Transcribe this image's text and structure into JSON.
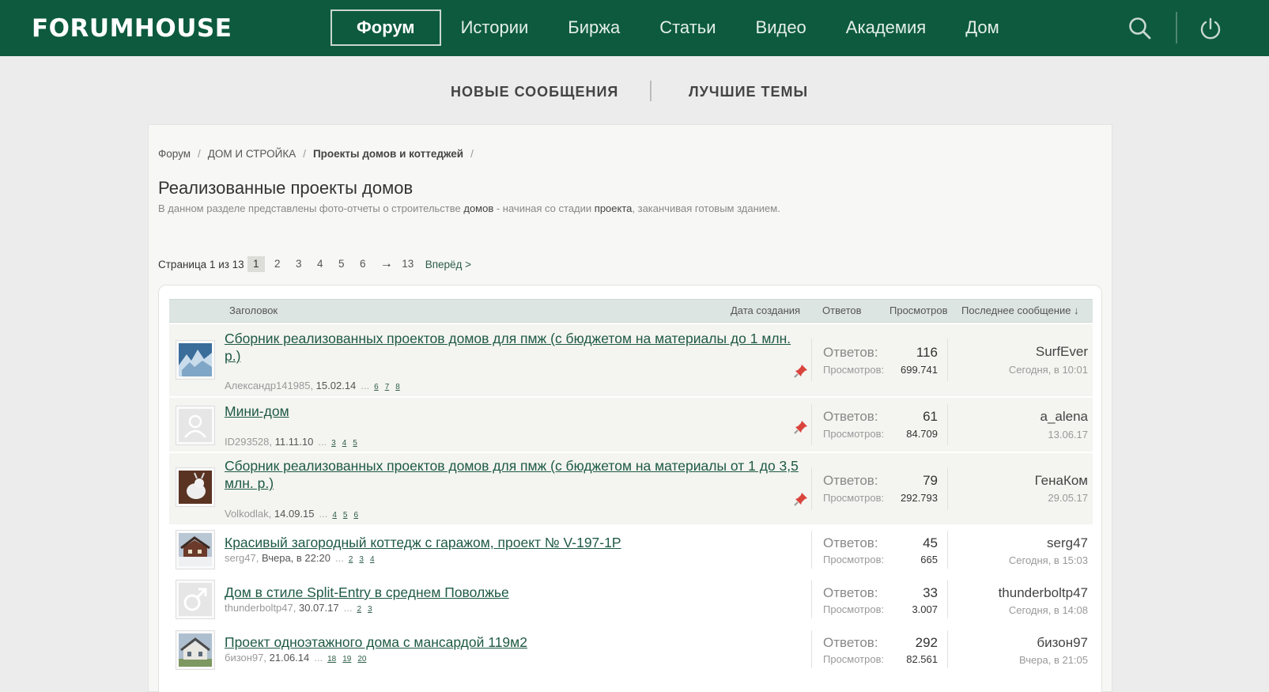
{
  "brand": {
    "logo": "FORUMHOUSE",
    "accent": "#0d5a3f"
  },
  "nav": {
    "items": [
      {
        "label": "Форум",
        "active": true
      },
      {
        "label": "Истории"
      },
      {
        "label": "Биржа"
      },
      {
        "label": "Статьи"
      },
      {
        "label": "Видео"
      },
      {
        "label": "Академия"
      },
      {
        "label": "Дом"
      }
    ],
    "icons": [
      "search-icon",
      "power-icon"
    ]
  },
  "subnav": {
    "new_messages": "НОВЫЕ СООБЩЕНИЯ",
    "best_topics": "ЛУЧШИЕ ТЕМЫ"
  },
  "breadcrumb": {
    "items": [
      "Форум",
      "ДОМ И СТРОЙКА",
      "Проекты домов и коттеджей"
    ],
    "sep": "/"
  },
  "page": {
    "title": "Реализованные проекты домов",
    "desc_1": "В данном разделе представлены фото-отчеты о строительстве ",
    "desc_2": "домов",
    "desc_3": " - начиная со стадии ",
    "desc_4": "проекта",
    "desc_5": ", заканчивая готовым зданием."
  },
  "pager": {
    "label": "Страница 1 из 13",
    "pages": [
      "1",
      "2",
      "3",
      "4",
      "5",
      "6"
    ],
    "arrow": "→",
    "last": "13",
    "next": "Вперёд >"
  },
  "list": {
    "headers": {
      "title": "Заголовок",
      "created": "Дата создания",
      "replies": "Ответов",
      "views": "Просмотров",
      "last": "Последнее сообщение ↓"
    },
    "replies_label": "Ответов:",
    "views_label": "Просмотров:",
    "threads": [
      {
        "title": "Сборник реализованных проектов домов для пмж (с бюджетом на материалы до 1 млн. р.)",
        "author": "Александр141985",
        "date": "15.02.14",
        "pages": [
          "6",
          "7",
          "8"
        ],
        "replies": "116",
        "views": "699.741",
        "last_user": "SurfEver",
        "last_date": "Сегодня, в 10:01",
        "sticky": true,
        "avatar_icon": "ice-photo-avatar"
      },
      {
        "title": "Мини-дом",
        "author": "ID293528",
        "date": "11.11.10",
        "pages": [
          "3",
          "4",
          "5"
        ],
        "replies": "61",
        "views": "84.709",
        "last_user": "a_alena",
        "last_date": "13.06.17",
        "sticky": true,
        "avatar_icon": "default-user-avatar"
      },
      {
        "title": "Сборник реализованных проектов домов для пмж (с бюджетом на материалы от 1 до 3,5 млн. р.)",
        "author": "Volkodlak",
        "date": "14.09.15",
        "pages": [
          "4",
          "5",
          "6"
        ],
        "replies": "79",
        "views": "292.793",
        "last_user": "ГенаКом",
        "last_date": "29.05.17",
        "sticky": true,
        "avatar_icon": "goat-photo-avatar"
      },
      {
        "title": "Красивый загородный коттедж с гаражом, проект № V-197-1P",
        "author": "serg47",
        "date": "Вчера, в 22:20",
        "pages": [
          "2",
          "3",
          "4"
        ],
        "replies": "45",
        "views": "665",
        "last_user": "serg47",
        "last_date": "Сегодня, в 15:03",
        "sticky": false,
        "avatar_icon": "house-photo-avatar"
      },
      {
        "title": "Дом в стиле Split-Entry в среднем Поволжье",
        "author": "thunderboltp47",
        "date": "30.07.17",
        "pages": [
          "2",
          "3"
        ],
        "replies": "33",
        "views": "3.007",
        "last_user": "thunderboltp47",
        "last_date": "Сегодня, в 14:08",
        "sticky": false,
        "avatar_icon": "male-symbol-avatar"
      },
      {
        "title": "Проект одноэтажного дома с мансардой 119м2",
        "author": "бизон97",
        "date": "21.06.14",
        "pages": [
          "18",
          "19",
          "20"
        ],
        "replies": "292",
        "views": "82.561",
        "last_user": "бизон97",
        "last_date": "Вчера, в 21:05",
        "sticky": false,
        "avatar_icon": "cottage-photo-avatar"
      }
    ]
  }
}
